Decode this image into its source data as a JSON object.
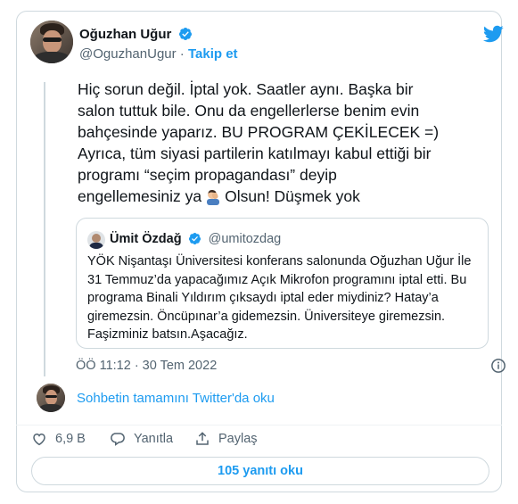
{
  "author": {
    "name": "Oğuzhan Uğur",
    "handle": "@OguzhanUgur",
    "separator": "·",
    "follow_label": "Takip et"
  },
  "tweet": {
    "text_before_emoji": "Hiç sorun değil. İptal yok. Saatler aynı. Başka bir\nsalon tuttuk bile. Onu da engellerlerse benim evin\nbahçesinde yaparız. BU PROGRAM ÇEKİLECEK =)\nAyrıca, tüm siyasi partilerin katılmayı kabul ettiği bir\nprogramı “seçim propagandası” deyip\nengellemesiniz ya",
    "text_after_emoji": "Olsun! Düşmek yok",
    "emoji": "man-facepalming-emoji",
    "timestamp": "ÖÖ 11:12 · 30 Tem 2022"
  },
  "quoted": {
    "name": "Ümit Özdağ",
    "handle": "@umitozdag",
    "text": "YÖK Nişantaşı Üniversitesi konferans salonunda Oğuzhan Uğur İle 31 Temmuz’da yapacağımız Açık Mikrofon programını iptal etti. Bu programa Binali Yıldırım çıksaydı iptal eder miydiniz? Hatay’a giremezsin. Öncüpınar’a gidemezsin. Üniversiteye giremezsin. Faşizminiz batsın.Aşacağız."
  },
  "thread_link": "Sohbetin tamamını Twitter'da oku",
  "actions": {
    "likes": "6,9 B",
    "reply_label": "Yanıtla",
    "share_label": "Paylaş"
  },
  "read_replies_label": "105 yanıtı oku",
  "colors": {
    "accent": "#1d9bf0",
    "text": "#0f1419",
    "secondary": "#536471",
    "border": "#cfd9de"
  }
}
